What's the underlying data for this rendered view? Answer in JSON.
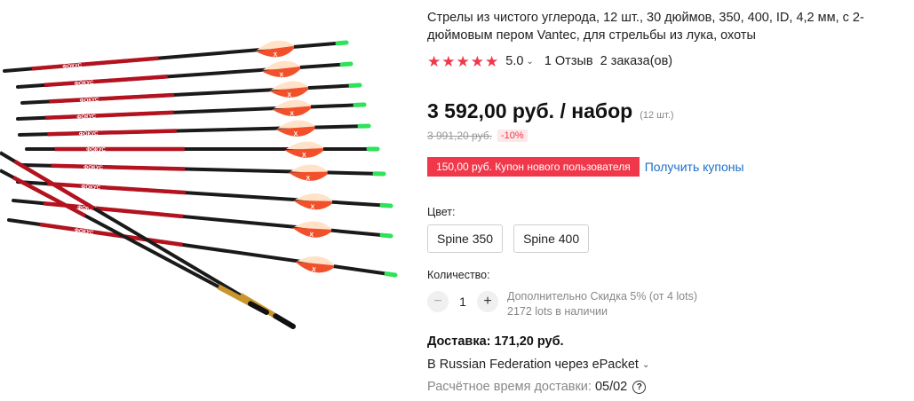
{
  "product": {
    "title": "Стрелы из чистого углерода, 12 шт., 30 дюймов, 350, 400, ID, 4,2 мм, с 2-дюймовым пером Vantec, для стрельбы из лука, охоты",
    "image_brand_text": "ФОКУС",
    "image_logo_text": "X"
  },
  "rating": {
    "stars": 5,
    "value": "5.0",
    "reviews": "1 Отзыв",
    "orders": "2 заказа(ов)",
    "star_color": "#f0384a"
  },
  "price": {
    "current": "3 592,00 руб. / набор",
    "unit": "(12 шт.)",
    "old": "3 991,20 руб.",
    "discount": "-10%"
  },
  "coupon": {
    "label": "150,00 руб. Купон нового пользователя",
    "link": "Получить купоны",
    "color": "#f0384a"
  },
  "color_section": {
    "label": "Цвет:",
    "options": [
      "Spine 350",
      "Spine 400"
    ]
  },
  "quantity": {
    "label": "Количество:",
    "value": "1",
    "extra_discount": "Дополнительно Скидка 5% (от 4 lots)",
    "stock": "2172 lots в наличии"
  },
  "delivery": {
    "title": "Доставка: 171,20 руб.",
    "method": "В Russian Federation через ePacket",
    "eta_label": "Расчётное время доставки:",
    "eta_value": "05/02"
  }
}
